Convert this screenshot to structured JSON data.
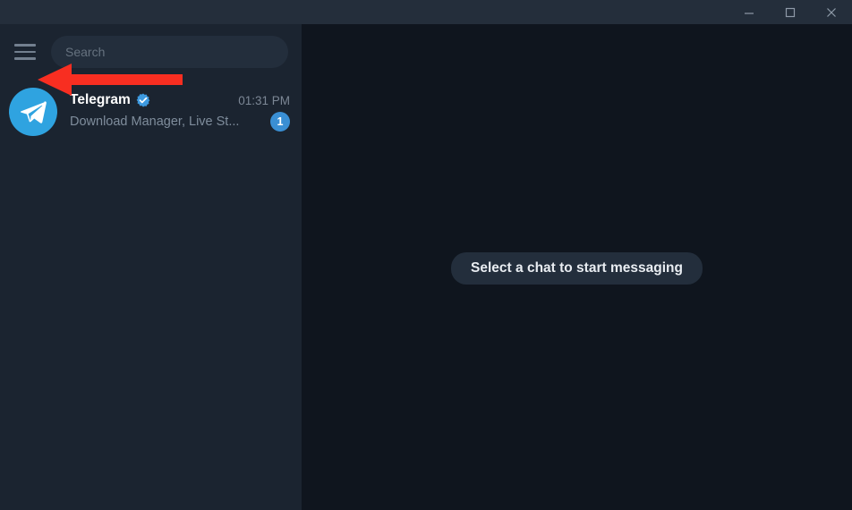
{
  "window": {
    "controls": [
      {
        "name": "minimize-button",
        "label": "—",
        "icon": "minimize-icon"
      },
      {
        "name": "maximize-button",
        "label": "□",
        "icon": "maximize-icon"
      },
      {
        "name": "close-button",
        "label": "✕",
        "icon": "close-icon"
      }
    ]
  },
  "sidebar": {
    "menu_icon": "hamburger-menu-icon",
    "search": {
      "placeholder": "Search",
      "value": ""
    },
    "chats": [
      {
        "avatar_icon": "telegram-plane-icon",
        "name": "Telegram",
        "verified": true,
        "verified_icon": "verified-badge-icon",
        "time": "01:31 PM",
        "preview": "Download Manager, Live St...",
        "unread": "1"
      }
    ]
  },
  "main": {
    "empty_state": "Select a chat to start messaging"
  },
  "annotation": {
    "arrow_color": "#f82e21",
    "arrow_name": "red-pointer-arrow"
  },
  "colors": {
    "titlebar": "#242e3b",
    "sidebar": "#1b2430",
    "main_panel": "#0f151e",
    "accent": "#2fa3e0",
    "badge": "#3a8fd4",
    "pill": "#232e3c"
  }
}
